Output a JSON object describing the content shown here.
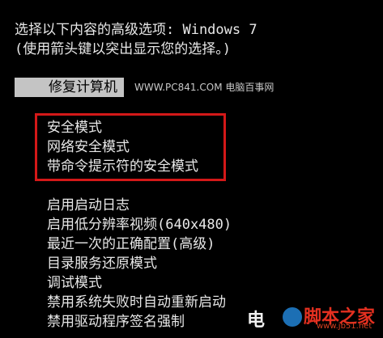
{
  "header": {
    "title": "选择以下内容的高级选项: Windows 7",
    "hint": "(使用箭头键以突出显示您的选择。)"
  },
  "repair": {
    "label": "修复计算机"
  },
  "watermark": {
    "text": "WWW.PC841.COM 电脑百事网"
  },
  "safe_modes": [
    "安全模式",
    "网络安全模式",
    "带命令提示符的安全模式"
  ],
  "options": [
    "启用启动日志",
    "启用低分辨率视频(640x480)",
    "最近一次的正确配置(高级)",
    "目录服务还原模式",
    "调试模式",
    "禁用系统失败时自动重新启动",
    "禁用驱动程序签名强制"
  ],
  "brand_logo": {
    "text": "电 脚本之家",
    "url": "www.jb51.net",
    "colors": {
      "circle": "#1c6fb4",
      "text": "#e43020"
    }
  },
  "colors": {
    "background": "#000000",
    "text": "#e8e8e8",
    "selection": "#c4c4c4",
    "highlight_border": "#d41818"
  }
}
